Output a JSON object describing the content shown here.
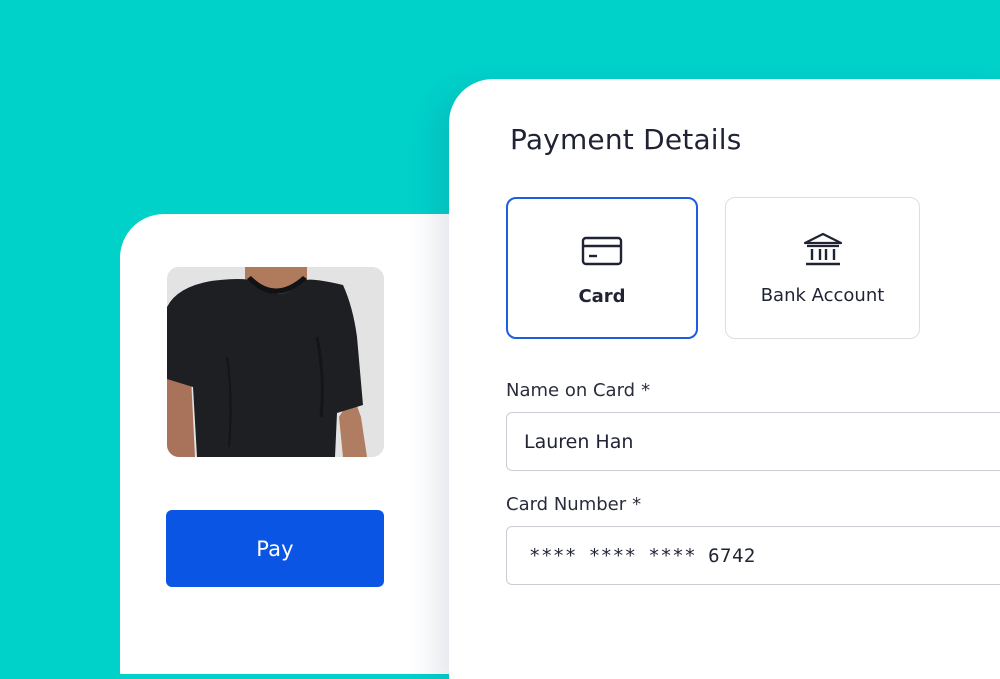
{
  "colors": {
    "background": "#00d1c9",
    "accent": "#0a55e4",
    "selected_border": "#1b5fe0"
  },
  "product": {
    "image": "black-tshirt-photo",
    "pay_label": "Pay"
  },
  "payment": {
    "title": "Payment Details",
    "methods": [
      {
        "label": "Card",
        "icon": "credit-card-icon",
        "selected": true
      },
      {
        "label": "Bank Account",
        "icon": "bank-icon",
        "selected": false
      }
    ],
    "fields": {
      "name": {
        "label": "Name on Card",
        "required": "*",
        "value": "Lauren Han"
      },
      "number": {
        "label": "Card Number",
        "required": "*",
        "value": "**** **** **** 6742"
      }
    }
  }
}
